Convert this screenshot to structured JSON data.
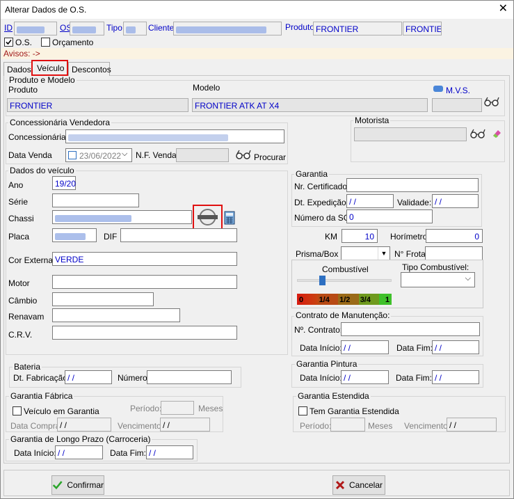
{
  "window": {
    "title": "Alterar Dados de O.S.",
    "close": "✕"
  },
  "header": {
    "id_label": "ID",
    "os_label": "OS",
    "tipo_label": "Tipo:",
    "cliente_label": "Cliente:",
    "produto_label": "Produto",
    "produto_value": "FRONTIER",
    "produto_value2": "FRONTIEF",
    "os_check": "O.S.",
    "orcamento_check": "Orçamento",
    "avisos": "Avisos: ->"
  },
  "tabs": [
    {
      "label": "Dados"
    },
    {
      "label": "Veículo"
    },
    {
      "label": "Descontos"
    }
  ],
  "produto_modelo": {
    "group": "Produto e Modelo",
    "produto_label": "Produto",
    "produto": "FRONTIER",
    "modelo_label": "Modelo",
    "modelo": "FRONTIER ATK AT X4",
    "mvs_label": "M.V.S."
  },
  "concessionaria": {
    "group": "Concessionária Vendedora",
    "concessionaria_label": "Concessionária",
    "data_venda_label": "Data Venda",
    "data_venda": "23/06/2022",
    "nf_label": "N.F. Venda:",
    "procurar": "Procurar"
  },
  "motorista": {
    "group": "Motorista"
  },
  "veiculo": {
    "group": "Dados do veículo",
    "ano_label": "Ano",
    "ano": "19/20",
    "serie_label": "Série",
    "chassi_label": "Chassi",
    "placa_label": "Placa",
    "dif_label": "DIF",
    "cor_label": "Cor Externa",
    "cor": "VERDE",
    "motor_label": "Motor",
    "cambio_label": "Câmbio",
    "renavam_label": "Renavam",
    "crv_label": "C.R.V.",
    "brand_logo": "NISSAN"
  },
  "garantia": {
    "group": "Garantia",
    "cert_label": "Nr. Certificado:",
    "expedicao_label": "Dt. Expedição:",
    "expedicao": " / /",
    "validade_label": "Validade:",
    "validade": " / /",
    "sg_label": "Número da SG:",
    "sg": "0"
  },
  "km": {
    "km_label": "KM",
    "km": "10",
    "horimetro_label": "Horímetro",
    "horimetro": "0",
    "prisma_label": "Prisma/Box",
    "frota_label": "N° Frota",
    "combustivel_label": "Combustível",
    "tipo_comb_label": "Tipo Combustível:",
    "fuel_level": 0.25,
    "fuel_scale": [
      "0",
      "1/4",
      "1/2",
      "3/4",
      "1"
    ]
  },
  "contrato": {
    "group": "Contrato de Manutenção:",
    "numero_label": "Nº. Contrato:",
    "inicio_label": "Data Início:",
    "inicio": " / /",
    "fim_label": "Data Fim:",
    "fim": " / /"
  },
  "bateria": {
    "group": "Bateria",
    "fab_label": "Dt. Fabricação",
    "fab": " / /",
    "numero_label": "Número"
  },
  "pintura": {
    "group": "Garantia Pintura",
    "inicio_label": "Data Início:",
    "inicio": " / /",
    "fim_label": "Data Fim:",
    "fim": " / /"
  },
  "fabrica": {
    "group": "Garantia Fábrica",
    "check": "Veículo em Garantia",
    "periodo_label": "Período:",
    "meses": "Meses",
    "compra_label": "Data Compra:",
    "compra": " / /",
    "venc_label": "Vencimento:",
    "venc": " / /"
  },
  "estendida": {
    "group": "Garantia Estendida",
    "check": "Tem Garantia Estendida",
    "periodo_label": "Período:",
    "meses": "Meses",
    "venc_label": "Vencimento:",
    "venc": " / /"
  },
  "longo": {
    "group": "Garantia de Longo Prazo (Carroceria)",
    "inicio_label": "Data Início:",
    "inicio": " / /",
    "fim_label": "Data Fim:",
    "fim": " / /"
  },
  "buttons": {
    "confirmar": "Confirmar",
    "cancelar": "Cancelar"
  },
  "colors": {
    "accent": "#0000c8",
    "highlight": "#e01010"
  }
}
